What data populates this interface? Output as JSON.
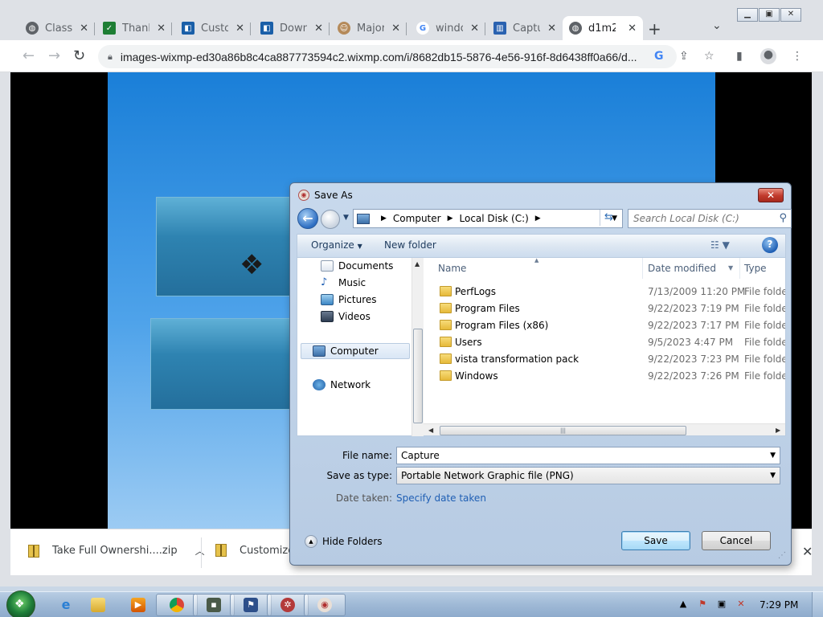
{
  "browser": {
    "tabs": [
      {
        "label": "Classic",
        "icon": "globe-icon",
        "active": false
      },
      {
        "label": "Thank",
        "icon": "check-square-icon",
        "active": false
      },
      {
        "label": "Custo",
        "icon": "blue-app-icon",
        "active": false
      },
      {
        "label": "Down",
        "icon": "blue-app-icon",
        "active": false
      },
      {
        "label": "Major",
        "icon": "avatar-icon",
        "active": false
      },
      {
        "label": "windo",
        "icon": "google-icon",
        "active": false
      },
      {
        "label": "Captu",
        "icon": "capture-icon",
        "active": false
      },
      {
        "label": "d1m2",
        "icon": "globe-icon",
        "active": true
      }
    ],
    "url": "images-wixmp-ed30a86b8c4ca887773594c2.wixmp.com/i/8682db15-5876-4e56-916f-8d6438ff0a66/d...",
    "downloads": [
      {
        "label": "Take Full Ownershi....zip"
      },
      {
        "label": "Customizer"
      }
    ]
  },
  "dialog": {
    "title": "Save As",
    "breadcrumb": [
      "Computer",
      "Local Disk (C:)"
    ],
    "search_placeholder": "Search Local Disk (C:)",
    "toolbar": {
      "organize": "Organize",
      "new_folder": "New folder"
    },
    "nav": {
      "libraries": [
        "Documents",
        "Music",
        "Pictures",
        "Videos"
      ],
      "computer": "Computer",
      "network": "Network"
    },
    "columns": {
      "name": "Name",
      "date": "Date modified",
      "type": "Type"
    },
    "files": [
      {
        "name": "PerfLogs",
        "date": "7/13/2009 11:20 PM",
        "type": "File folder"
      },
      {
        "name": "Program Files",
        "date": "9/22/2023 7:19 PM",
        "type": "File folder"
      },
      {
        "name": "Program Files (x86)",
        "date": "9/22/2023 7:17 PM",
        "type": "File folder"
      },
      {
        "name": "Users",
        "date": "9/5/2023 4:47 PM",
        "type": "File folder"
      },
      {
        "name": "vista transformation pack",
        "date": "9/22/2023 7:23 PM",
        "type": "File folder"
      },
      {
        "name": "Windows",
        "date": "9/22/2023 7:26 PM",
        "type": "File folder"
      }
    ],
    "file_name_label": "File name:",
    "file_name": "Capture",
    "save_type_label": "Save as type:",
    "save_type": "Portable Network Graphic file (PNG)",
    "date_taken_label": "Date taken:",
    "date_taken_link": "Specify date taken",
    "hide_folders": "Hide Folders",
    "save": "Save",
    "cancel": "Cancel"
  },
  "taskbar": {
    "clock": "7:29 PM"
  }
}
